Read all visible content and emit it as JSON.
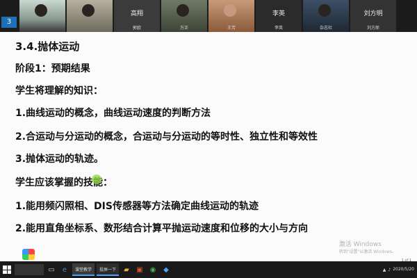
{
  "video": {
    "side_badge": "3",
    "tiles": [
      {
        "name": ""
      },
      {
        "name": ""
      },
      {
        "name": "郭欧",
        "big": "高翔"
      },
      {
        "name": "万正"
      },
      {
        "name": "王芳"
      },
      {
        "name": "李英",
        "big": "李英"
      },
      {
        "name": "杂志社"
      },
      {
        "name": "刘方郎",
        "big": "刘方明"
      }
    ]
  },
  "slide": {
    "title": "3.4.抛体运动",
    "lines": [
      "阶段1：预期结果",
      "学生将理解的知识：",
      "1.曲线运动的概念，曲线运动速度的判断方法",
      "2.合运动与分运动的概念，合运动与分运动的等时性、独立性和等效性",
      "3.抛体运动的轨迹。",
      "学生应该掌握的技能：",
      "1.能用频闪照相、DIS传感器等方法确定曲线运动的轨迹",
      "2.能用直角坐标系、数形结合计算平抛运动速度和位移的大小与方向"
    ],
    "watermark_line1": "激活 Windows",
    "watermark_line2": "转到\"设置\"以激活 Windows。",
    "page_info": "1 of 1"
  },
  "taskbar": {
    "search_text": "",
    "apps": [
      "课堂教学",
      "投屏一下"
    ],
    "time": "",
    "date": "2020/5/20"
  }
}
